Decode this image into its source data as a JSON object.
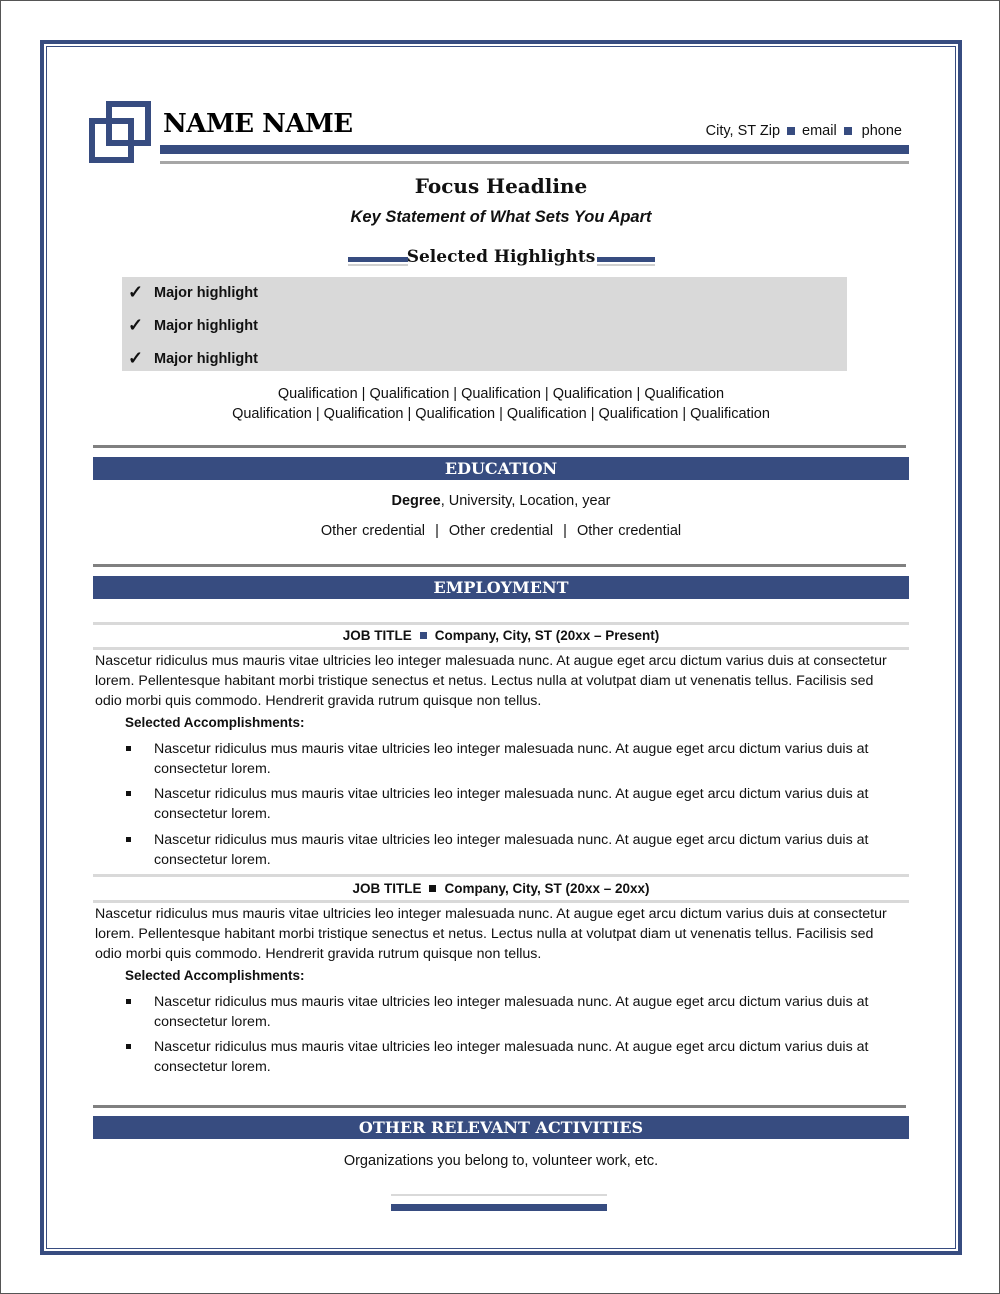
{
  "header": {
    "name": "NAME NAME",
    "contact": {
      "city": "City, ST Zip",
      "email": "email",
      "phone": "phone"
    }
  },
  "focus": {
    "headline": "Focus Headline",
    "key_statement": "Key Statement of What Sets You Apart"
  },
  "highlights": {
    "title": "Selected Highlights",
    "items": [
      "Major highlight",
      "Major highlight",
      "Major highlight"
    ],
    "check_glyph": "✓"
  },
  "qualifications": {
    "line1": "Qualification | Qualification | Qualification | Qualification | Qualification",
    "line2": "Qualification | Qualification | Qualification | Qualification | Qualification | Qualification"
  },
  "education": {
    "title": "EDUCATION",
    "degree_bold": "Degree",
    "degree_rest": ", University, Location, year",
    "credentials": "Other credential  |  Other credential  |  Other credential"
  },
  "employment": {
    "title": "EMPLOYMENT",
    "jobs": [
      {
        "title": "JOB TITLE",
        "company": "Company, City, ST (20xx – Present)",
        "description": "Nascetur ridiculus mus mauris vitae ultricies leo integer malesuada nunc. At augue eget arcu dictum varius duis at consectetur lorem. Pellentesque habitant morbi tristique senectus et netus. Lectus nulla at volutpat diam ut venenatis tellus. Facilisis sed odio morbi quis commodo. Hendrerit gravida rutrum quisque non tellus.",
        "accomplishments_label": "Selected Accomplishments:",
        "accomplishments": [
          "Nascetur ridiculus mus mauris vitae ultricies leo integer malesuada nunc. At augue eget arcu dictum varius duis at consectetur lorem.",
          "Nascetur ridiculus mus mauris vitae ultricies leo integer malesuada nunc. At augue eget arcu dictum varius duis at consectetur lorem.",
          "Nascetur ridiculus mus mauris vitae ultricies leo integer malesuada nunc. At augue eget arcu dictum varius duis at consectetur lorem."
        ]
      },
      {
        "title": "JOB TITLE",
        "company": "Company, City, ST (20xx – 20xx)",
        "description": "Nascetur ridiculus mus mauris vitae ultricies leo integer malesuada nunc. At augue eget arcu dictum varius duis at consectetur lorem. Pellentesque habitant morbi tristique senectus et netus. Lectus nulla at volutpat diam ut venenatis tellus. Facilisis sed odio morbi quis commodo. Hendrerit gravida rutrum quisque non tellus.",
        "accomplishments_label": "Selected Accomplishments:",
        "accomplishments": [
          "Nascetur ridiculus mus mauris vitae ultricies leo integer malesuada nunc. At augue eget arcu dictum varius duis at consectetur lorem.",
          "Nascetur ridiculus mus mauris vitae ultricies leo integer malesuada nunc. At augue eget arcu dictum varius duis at consectetur lorem."
        ]
      }
    ]
  },
  "activities": {
    "title": "OTHER RELEVANT ACTIVITIES",
    "text": "Organizations you belong to, volunteer work, etc."
  },
  "colors": {
    "accent": "#374c80",
    "rule_gray": "#808080",
    "highlight_bg": "#d9d9d9"
  }
}
